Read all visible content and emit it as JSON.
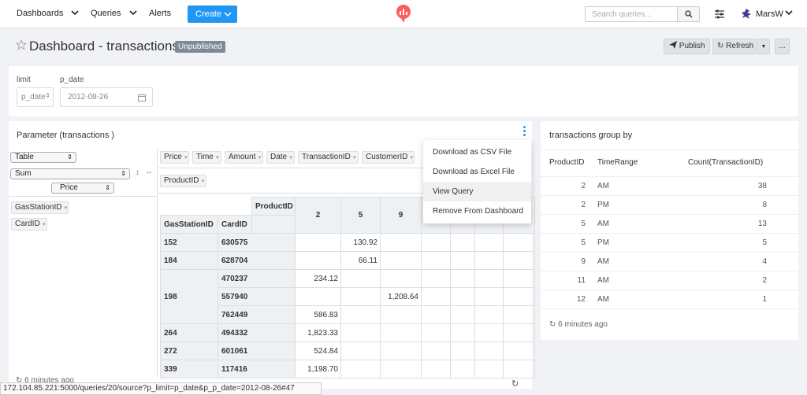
{
  "nav": {
    "dashboards": "Dashboards",
    "queries": "Queries",
    "alerts": "Alerts",
    "create": "Create",
    "search_placeholder": "Search queries...",
    "user": "MarsW"
  },
  "header": {
    "title": "Dashboard - transactions",
    "badge": "Unpublished",
    "publish": "Publish",
    "refresh": "Refresh",
    "more": "..."
  },
  "params": {
    "limit_label": "limit",
    "limit_value": "p_date",
    "pdate_label": "p_date",
    "pdate_value": "2012-08-26"
  },
  "left_widget": {
    "title": "Parameter (transactions )",
    "renderer": "Table",
    "aggregator": "Sum",
    "agg_field": "Price",
    "unused_attrs": [
      "Price",
      "Time",
      "Amount",
      "Date",
      "TransactionID",
      "CustomerID"
    ],
    "col_attr": "ProductID",
    "row_attrs": [
      "GasStationID",
      "CardID"
    ],
    "table": {
      "col_header": "ProductID",
      "row_headers": [
        "GasStationID",
        "CardID"
      ],
      "columns": [
        "2",
        "5",
        "9"
      ],
      "rows": [
        {
          "gas": "152",
          "card": "630575",
          "v2": "",
          "v5": "130.92",
          "v9": ""
        },
        {
          "gas": "184",
          "card": "628704",
          "v2": "",
          "v5": "66.11",
          "v9": ""
        },
        {
          "gas": "198",
          "card": "470237",
          "v2": "234.12",
          "v5": "",
          "v9": ""
        },
        {
          "gas": "",
          "card": "557940",
          "v2": "",
          "v5": "",
          "v9": "1,208.64"
        },
        {
          "gas": "",
          "card": "762449",
          "v2": "586.83",
          "v5": "",
          "v9": ""
        },
        {
          "gas": "264",
          "card": "494332",
          "v2": "1,823.33",
          "v5": "",
          "v9": ""
        },
        {
          "gas": "272",
          "card": "601061",
          "v2": "524.84",
          "v5": "",
          "v9": ""
        },
        {
          "gas": "339",
          "card": "117416",
          "v2": "1,198.70",
          "v5": "",
          "v9": ""
        }
      ]
    },
    "updated": "6 minutes ago",
    "menu": [
      "Download as CSV File",
      "Download as Excel File",
      "View Query",
      "Remove From Dashboard"
    ]
  },
  "right_widget": {
    "title": "transactions group by",
    "headers": [
      "ProductID",
      "TimeRange",
      "Count(TransactionID)"
    ],
    "rows": [
      {
        "pid": "2",
        "tr": "AM",
        "count": "38"
      },
      {
        "pid": "2",
        "tr": "PM",
        "count": "8"
      },
      {
        "pid": "5",
        "tr": "AM",
        "count": "13"
      },
      {
        "pid": "5",
        "tr": "PM",
        "count": "5"
      },
      {
        "pid": "9",
        "tr": "AM",
        "count": "4"
      },
      {
        "pid": "11",
        "tr": "AM",
        "count": "2"
      },
      {
        "pid": "12",
        "tr": "AM",
        "count": "1"
      }
    ],
    "updated": "6 minutes ago"
  },
  "status_url": "172.104.85.221:5000/queries/20/source?p_limit=p_date&p_p_date=2012-08-26#47",
  "colors": {
    "accent": "#2196f3",
    "badge": "#7d8a98",
    "logo": "#ff5c5c"
  }
}
